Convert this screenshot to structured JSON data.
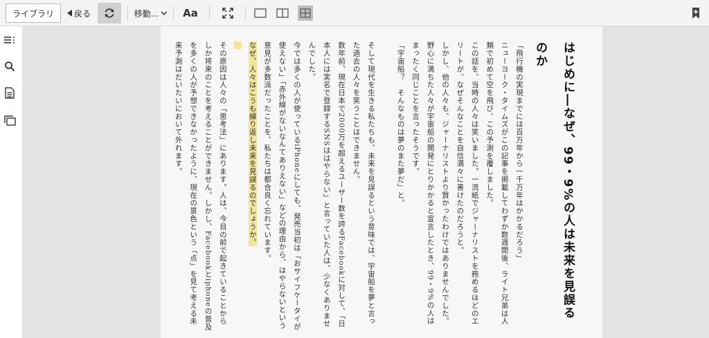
{
  "toolbar": {
    "library_label": "ライブラリ",
    "back_label": "戻る",
    "move_label": "移動...",
    "font_label": "Aa"
  },
  "book": {
    "chapter_title": "はじめに―なぜ、99・9%の人は未来を見誤るのか",
    "paragraphs": [
      "「飛行機の実現までには百万年から一千万年はかかるだろう」",
      "ニューヨーク・タイムズがこの記事を掲載してわずか数週間後、ライト兄弟は人類で初めて空を飛び、この予測を覆しました。",
      "この話を、当時の人々は笑いました。一流紙でジャーナリストを務めるほどのエリートが、なぜそんなことを自信満々に書けたのだろうと。",
      "しかし、他の人々も、ジャーナリストより賢かったわけではありませんでした。野心に満ちた人々が宇宙船の開発にとりかかると宣言したとき、99・9%の人はまったく同じことを言ったそうです。",
      "「宇宙船？　そんなものは夢のまた夢だ」と。",
      "",
      "そして現代を生きる私たちも、未来を見誤るという意味では、宇宙船を夢と言った過去の人々を笑うことはできません。",
      "数年前、現在日本で2000万を超えるユーザー数を誇るFacebookに対して、「日本人には実名で登録するSNSははやらない」と言っていた人は、少なくありませんでした。",
      "今では多くの人が使っているiPhoneにしても、発売当初は「おサイフケータイが使えない」「赤外線がないなんてありえない」などの理由から、はやらないという意見が多数派だったことを、私たちは都合良く忘れています。",
      "なぜ、人々はこうも繰り返し未来を見誤るのでしょうか。",
      "",
      "その原因は人々の「思考法」にあります。人は、今目の前で起きていることからしか将来のことを考えることができません。しかし、Facebookとiphoneの普及を多くの人が予想できなかったように、現在の景色という「点」を見て考える未来予測はだいたいにおいて外れます。"
    ]
  }
}
